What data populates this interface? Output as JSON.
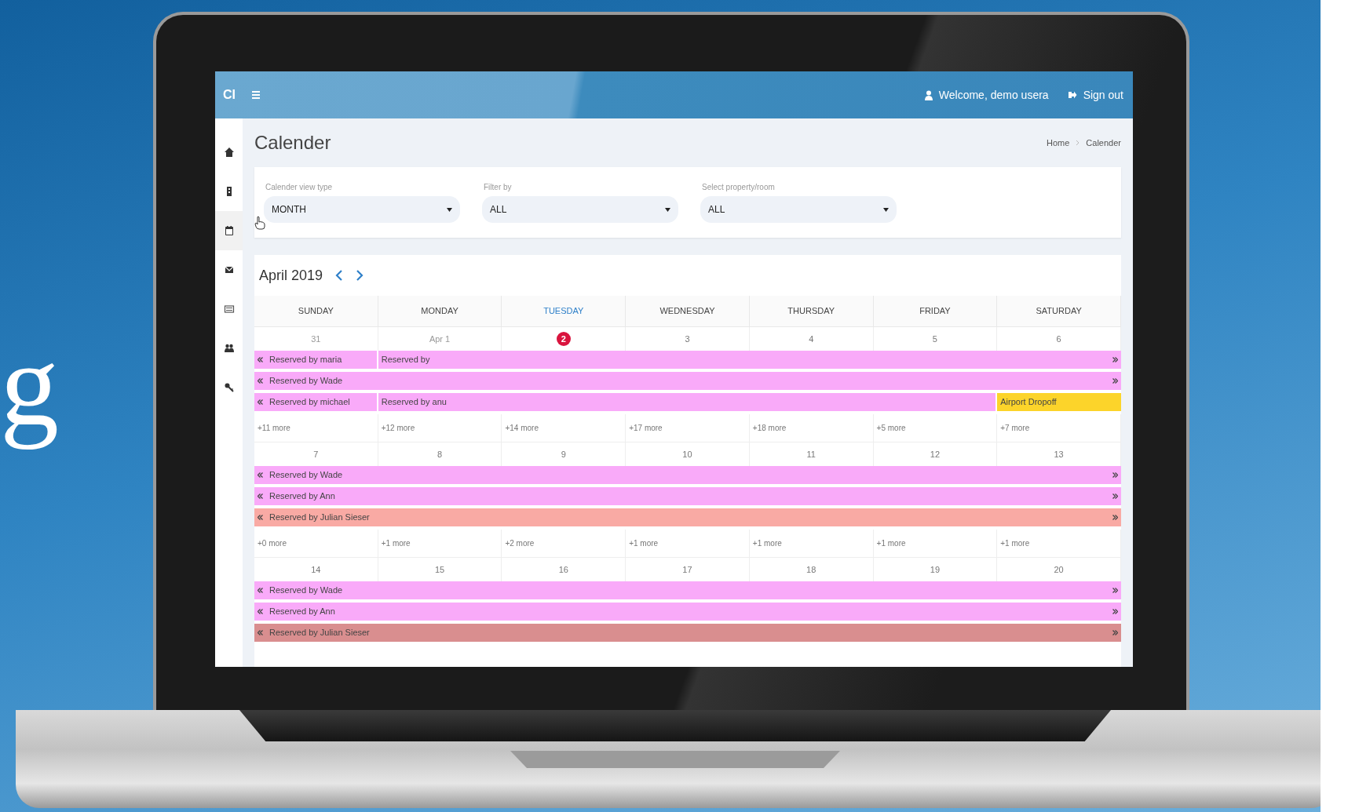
{
  "backdrop": {
    "letter": "g"
  },
  "app": {
    "brand": "CI",
    "welcome": "Welcome, demo usera",
    "sign_out": "Sign out",
    "sidebar": [
      {
        "kind": "home",
        "selected": false
      },
      {
        "kind": "building",
        "selected": false
      },
      {
        "kind": "calendar",
        "selected": true
      },
      {
        "kind": "inbox",
        "selected": false
      },
      {
        "kind": "card",
        "selected": false
      },
      {
        "kind": "users",
        "selected": false
      },
      {
        "kind": "key",
        "selected": false
      }
    ],
    "page_title": "Calender",
    "breadcrumb": [
      "Home",
      "Calender"
    ],
    "filters": [
      {
        "label": "Calender view type",
        "value": "MONTH"
      },
      {
        "label": "Filter by",
        "value": "ALL"
      },
      {
        "label": "Select property/room",
        "value": "ALL"
      }
    ],
    "calendar": {
      "month": "April 2019",
      "weekdays": [
        {
          "label": "SUNDAY",
          "today": false
        },
        {
          "label": "MONDAY",
          "today": false
        },
        {
          "label": "TUESDAY",
          "today": true
        },
        {
          "label": "WEDNESDAY",
          "today": false
        },
        {
          "label": "THURSDAY",
          "today": false
        },
        {
          "label": "FRIDAY",
          "today": false
        },
        {
          "label": "SATURDAY",
          "today": false
        }
      ],
      "weeks": [
        {
          "days": [
            {
              "date": "31",
              "today": false,
              "other_month": true
            },
            {
              "date": "Apr 1",
              "today": false,
              "other_month": true
            },
            {
              "date": "2",
              "today": true,
              "other_month": false
            },
            {
              "date": "3",
              "today": false,
              "other_month": false
            },
            {
              "date": "4",
              "today": false,
              "other_month": false
            },
            {
              "date": "5",
              "today": false,
              "other_month": false
            },
            {
              "date": "6",
              "today": false,
              "other_month": false
            }
          ],
          "lanes": [
            {
              "cells": [
                {
                  "label": "Reserved by maria",
                  "color": "#f9aaf9",
                  "continues_left": true,
                  "continues_right": false
                },
                {
                  "label": "Reserved by",
                  "color": "#f9aaf9",
                  "continues_left": false,
                  "continues_right": true
                },
                {},
                {},
                {},
                {},
                {}
              ]
            },
            {
              "cells": [
                {
                  "label": "Reserved by Wade",
                  "color": "#f9aaf9",
                  "continues_left": true,
                  "continues_right": true
                },
                {},
                {},
                {},
                {},
                {},
                {}
              ]
            },
            {
              "cells": [
                {
                  "label": "Reserved by michael",
                  "color": "#f9aaf9",
                  "continues_left": true,
                  "continues_right": false
                },
                {
                  "label": "Reserved by anu",
                  "color": "#f9aaf9",
                  "continues_left": false,
                  "continues_right": false
                },
                {},
                {},
                {},
                {},
                {
                  "label": "Airport Dropoff",
                  "color": "#fcd42a",
                  "continues_left": false,
                  "continues_right": false
                }
              ]
            }
          ],
          "more": [
            "+11 more",
            "+12 more",
            "+14 more",
            "+17 more",
            "+18 more",
            "+5 more",
            "+7 more"
          ]
        },
        {
          "days": [
            {
              "date": "7",
              "today": false,
              "other_month": false
            },
            {
              "date": "8",
              "today": false,
              "other_month": false
            },
            {
              "date": "9",
              "today": false,
              "other_month": false
            },
            {
              "date": "10",
              "today": false,
              "other_month": false
            },
            {
              "date": "11",
              "today": false,
              "other_month": false
            },
            {
              "date": "12",
              "today": false,
              "other_month": false
            },
            {
              "date": "13",
              "today": false,
              "other_month": false
            }
          ],
          "lanes": [
            {
              "cells": [
                {
                  "label": "Reserved by Wade",
                  "color": "#f9aaf9",
                  "continues_left": true,
                  "continues_right": true
                },
                {},
                {},
                {},
                {},
                {},
                {}
              ]
            },
            {
              "cells": [
                {
                  "label": "Reserved by Ann",
                  "color": "#f9aaf9",
                  "continues_left": true,
                  "continues_right": true
                },
                {},
                {},
                {},
                {},
                {},
                {}
              ]
            },
            {
              "cells": [
                {
                  "label": "Reserved by Julian Sieser",
                  "color": "#f9aaa4",
                  "continues_left": true,
                  "continues_right": true
                },
                {},
                {},
                {},
                {},
                {},
                {}
              ]
            }
          ],
          "more": [
            "+0 more",
            "+1 more",
            "+2 more",
            "+1 more",
            "+1 more",
            "+1 more",
            "+1 more"
          ]
        },
        {
          "days": [
            {
              "date": "14",
              "today": false,
              "other_month": false
            },
            {
              "date": "15",
              "today": false,
              "other_month": false
            },
            {
              "date": "16",
              "today": false,
              "other_month": false
            },
            {
              "date": "17",
              "today": false,
              "other_month": false
            },
            {
              "date": "18",
              "today": false,
              "other_month": false
            },
            {
              "date": "19",
              "today": false,
              "other_month": false
            },
            {
              "date": "20",
              "today": false,
              "other_month": false
            }
          ],
          "lanes": [
            {
              "cells": [
                {
                  "label": "Reserved by Wade",
                  "color": "#f9aaf9",
                  "continues_left": true,
                  "continues_right": true
                },
                {},
                {},
                {},
                {},
                {},
                {}
              ]
            },
            {
              "cells": [
                {
                  "label": "Reserved by Ann",
                  "color": "#f9aaf9",
                  "continues_left": true,
                  "continues_right": true
                },
                {},
                {},
                {},
                {},
                {},
                {}
              ]
            },
            {
              "cells": [
                {
                  "label": "Reserved by Julian Sieser",
                  "color": "#d98e8f",
                  "continues_left": true,
                  "continues_right": true
                },
                {},
                {},
                {},
                {},
                {},
                {}
              ]
            }
          ]
        }
      ]
    }
  }
}
